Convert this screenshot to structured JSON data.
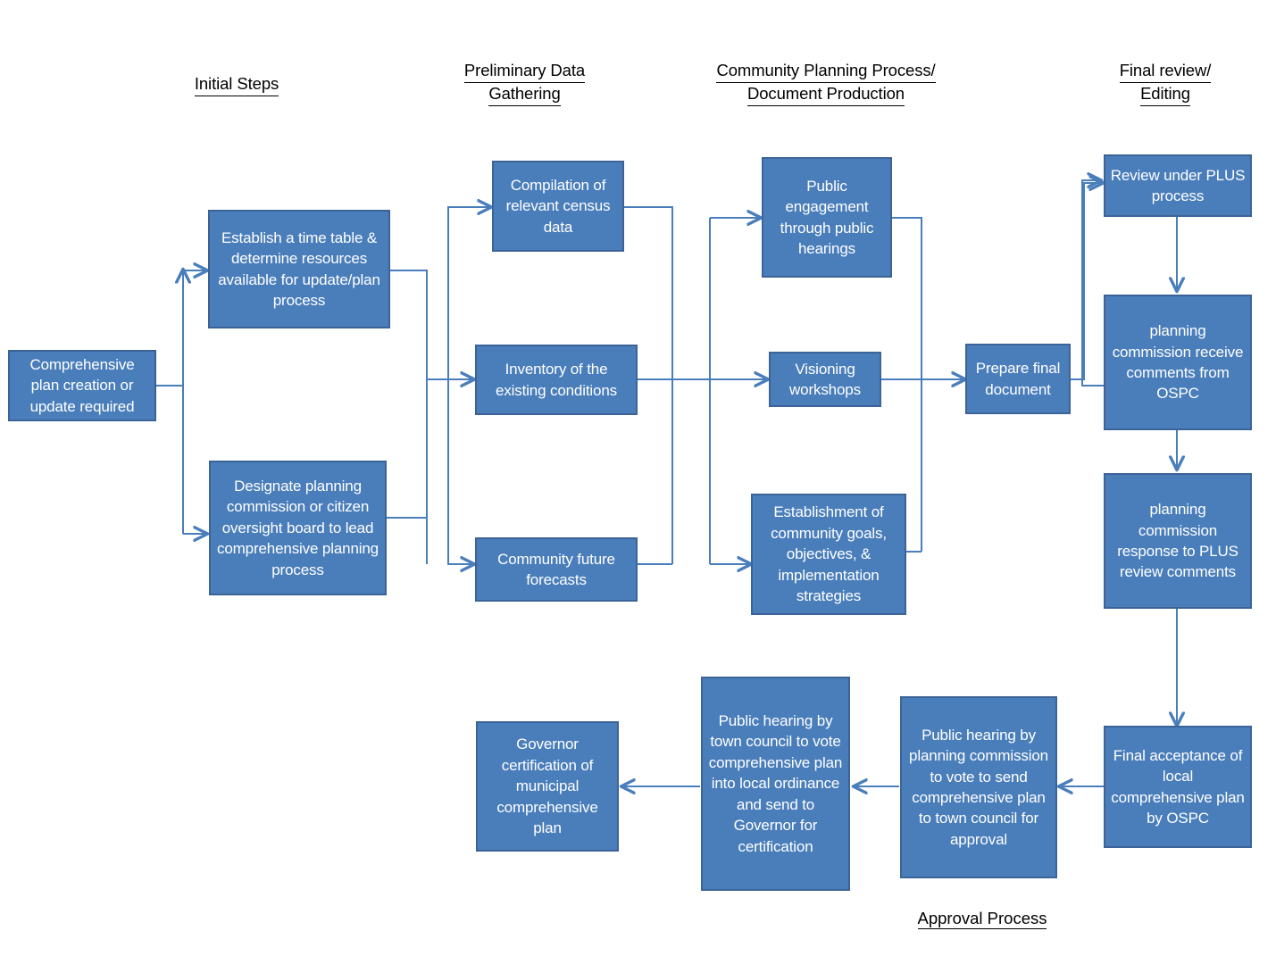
{
  "diagram": {
    "title": "Comprehensive Plan Development Process Flowchart",
    "accent_color": "#4a7ebb",
    "border_color": "#3c6397",
    "connector_color": "#4a7ebb",
    "text_color": "#ffffff"
  },
  "column_headers": [
    {
      "id": "header-initial-steps",
      "lines": [
        "Initial Steps"
      ]
    },
    {
      "id": "header-preliminary-data",
      "lines": [
        "Preliminary Data ",
        "Gathering"
      ]
    },
    {
      "id": "header-community-planning",
      "lines": [
        "Community Planning Process/",
        "Document Production"
      ]
    },
    {
      "id": "header-final-review",
      "lines": [
        "Final review/",
        "Editing"
      ]
    }
  ],
  "section_labels": [
    {
      "id": "label-approval-process",
      "text": "Approval Process"
    }
  ],
  "nodes": [
    {
      "id": "comprehensive-plan-creation",
      "text": "Comprehensive plan creation or update required"
    },
    {
      "id": "establish-time-table",
      "text": "Establish a time table & determine resources available for update/plan process"
    },
    {
      "id": "designate-planning-commission",
      "text": "Designate planning commission or citizen oversight board to lead comprehensive planning process"
    },
    {
      "id": "compilation-census-data",
      "text": "Compilation of relevant census data"
    },
    {
      "id": "inventory-existing-conditions",
      "text": "Inventory of the existing conditions"
    },
    {
      "id": "community-future-forecasts",
      "text": "Community future forecasts"
    },
    {
      "id": "public-engagement-hearings",
      "text": "Public engagement through public hearings"
    },
    {
      "id": "visioning-workshops",
      "text": "Visioning workshops"
    },
    {
      "id": "establishment-community-goals",
      "text": "Establishment of community goals, objectives, & implementation strategies"
    },
    {
      "id": "prepare-final-document",
      "text": "Prepare final document"
    },
    {
      "id": "review-under-plus",
      "text": "Review under PLUS process"
    },
    {
      "id": "planning-commission-receive-comments",
      "text": "planning commission receive comments from OSPC"
    },
    {
      "id": "planning-commission-response",
      "text": "planning commission response to PLUS review comments"
    },
    {
      "id": "final-acceptance-ospc",
      "text": "Final acceptance of local comprehensive plan by OSPC"
    },
    {
      "id": "public-hearing-planning-commission",
      "text": "Public hearing by planning commission to vote to send comprehensive plan to town council for approval"
    },
    {
      "id": "public-hearing-town-council",
      "text": "Public hearing by town council to vote comprehensive plan into local ordinance and send to Governor for certification"
    },
    {
      "id": "governor-certification",
      "text": "Governor certification of municipal comprehensive plan"
    }
  ]
}
